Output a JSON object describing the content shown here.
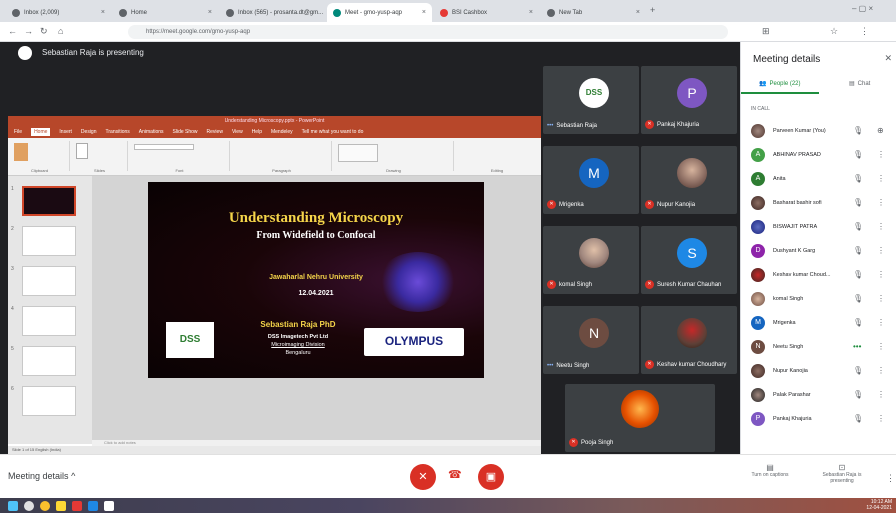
{
  "browser": {
    "tabs": [
      {
        "label": "Inbox (2,009)"
      },
      {
        "label": "Home"
      },
      {
        "label": "Inbox (565) - prosanta.dt@gm..."
      },
      {
        "label": "Meet - gmo-yusp-aqp"
      },
      {
        "label": "BSI Cashbox"
      },
      {
        "label": "New Tab"
      }
    ],
    "active_tab_index": 3,
    "url": "https://meet.google.com/gmo-yusp-aqp"
  },
  "presenting": {
    "text": "Sebastian Raja is presenting"
  },
  "powerpoint": {
    "window_title": "Understanding Microscopy.pptx - PowerPoint",
    "ribbon_tabs": [
      "File",
      "Home",
      "Insert",
      "Design",
      "Transitions",
      "Animations",
      "Slide Show",
      "Review",
      "View",
      "Help",
      "Mendeley",
      "Tell me what you want to do"
    ],
    "active_ribbon_tab": "Home",
    "groups": [
      "Clipboard",
      "Slides",
      "Font",
      "Paragraph",
      "Drawing",
      "Editing"
    ],
    "notes_placeholder": "Click to add notes",
    "status": "Slide 1 of 15    English (India)",
    "slide": {
      "title": "Understanding Microscopy",
      "subtitle": "From Widefield to Confocal",
      "venue": "Jawaharlal Nehru University",
      "date": "12.04.2021",
      "presenter": "Sebastian Raja PhD",
      "company": "DSS Imagetech Pvt Ltd",
      "division": "Microimaging Division",
      "city": "Bengaluru",
      "olympus": "OLYMPUS",
      "dss_logo": "DSS"
    }
  },
  "tiles": [
    {
      "name": "Sebastian Raja",
      "avatar": "DSS",
      "avatar_color": "#ffffff",
      "muted": false
    },
    {
      "name": "Pankaj Khajuria",
      "avatar": "P",
      "avatar_color": "#7e57c2",
      "muted": true
    },
    {
      "name": "Mrigenka",
      "avatar": "M",
      "avatar_color": "#1565c0",
      "muted": true
    },
    {
      "name": "Nupur Kanojia",
      "avatar": "photo",
      "avatar_color": "#8d6e63",
      "muted": true
    },
    {
      "name": "komal Singh",
      "avatar": "photo",
      "avatar_color": "#a1887f",
      "muted": true
    },
    {
      "name": "Suresh Kumar Chauhan",
      "avatar": "S",
      "avatar_color": "#1e88e5",
      "muted": true
    },
    {
      "name": "Neetu Singh",
      "avatar": "N",
      "avatar_color": "#6d4c41",
      "muted": false
    },
    {
      "name": "Keshav kumar Choudhary",
      "avatar": "photo",
      "avatar_color": "#5d4037",
      "muted": true
    },
    {
      "name": "Pooja Singh",
      "avatar": "photo",
      "avatar_color": "#e65100",
      "muted": true
    }
  ],
  "panel": {
    "title": "Meeting details",
    "people_tab": "People (22)",
    "chat_tab": "Chat",
    "in_call_label": "IN CALL",
    "people": [
      {
        "name": "Parveen Kumar (You)",
        "avatar": "photo",
        "color": "#6d4c41"
      },
      {
        "name": "ABHINAV PRASAD",
        "avatar": "A",
        "color": "#43a047"
      },
      {
        "name": "Anita",
        "avatar": "A",
        "color": "#2e7d32"
      },
      {
        "name": "Basharat bashir sofi",
        "avatar": "photo",
        "color": "#5d4037"
      },
      {
        "name": "BISWAJIT PATRA",
        "avatar": "photo",
        "color": "#283593"
      },
      {
        "name": "Dushyant K Garg",
        "avatar": "D",
        "color": "#8e24aa"
      },
      {
        "name": "Keshav kumar Choud...",
        "avatar": "photo",
        "color": "#6d4c41"
      },
      {
        "name": "komal Singh",
        "avatar": "photo",
        "color": "#8d6e63"
      },
      {
        "name": "Mrigenka",
        "avatar": "M",
        "color": "#1565c0"
      },
      {
        "name": "Neetu Singh",
        "avatar": "N",
        "color": "#6d4c41"
      },
      {
        "name": "Nupur Kanojia",
        "avatar": "photo",
        "color": "#5d4037"
      },
      {
        "name": "Palak Parashar",
        "avatar": "photo",
        "color": "#795548"
      },
      {
        "name": "Pankaj Khajuria",
        "avatar": "P",
        "color": "#7e57c2"
      }
    ]
  },
  "bottom": {
    "meeting_details": "Meeting details",
    "captions": "Turn on captions",
    "presenting": "Sebastian Raja is presenting"
  },
  "taskbar": {
    "time": "10:12 AM",
    "date": "12-04-2021"
  }
}
